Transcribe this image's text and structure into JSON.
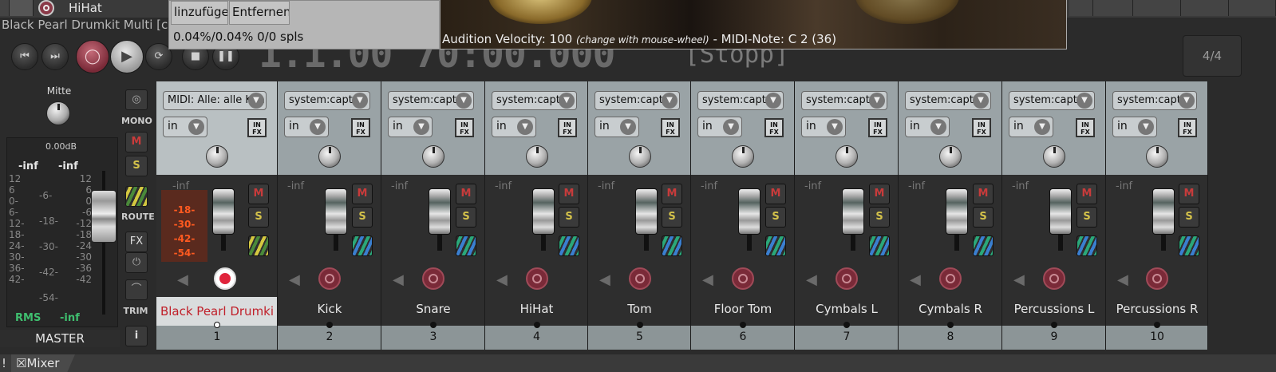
{
  "top": {
    "track_name": "HiHat",
    "session_title": "Black Pearl Drumkit Multi [cl"
  },
  "popup": {
    "btn_add": "linzufüge",
    "btn_remove": "Entfernen",
    "stats": "0.04%/0.04% 0/0 spls",
    "audition_label": "Audition Velocity: 100",
    "audition_hint": "(change with mouse-wheel)",
    "midi_note": "-  MIDI-Note: C 2 (36)"
  },
  "transport": {
    "clock": "1.1.00 70:00.000",
    "status": "[Stopp]",
    "time_sig": "4/4"
  },
  "master": {
    "pan_label": "Mitte",
    "gain": "0.00dB",
    "peak_left": "-inf",
    "peak_right": "-inf",
    "scale_left": [
      "12",
      "6",
      "0-",
      "6-",
      "12-",
      "18-",
      "24-",
      "30-",
      "36-",
      "42-"
    ],
    "scale_mid": [
      "-6-",
      "-18-",
      "-30-",
      "-42-",
      "-54-"
    ],
    "scale_right": [
      "12",
      "6",
      "0",
      "-6",
      "-12",
      "-18",
      "-24",
      "-30",
      "-36",
      "-42"
    ],
    "rms_label": "RMS",
    "rms_value": "-inf",
    "label": "MASTER"
  },
  "side": {
    "mono": "MONO",
    "mute": "M",
    "solo": "S",
    "route": "ROUTE",
    "fx": "FX",
    "trim": "TRIM",
    "info": "i"
  },
  "strips": [
    {
      "input": "MIDI: Alle: alle Kan",
      "in": "in",
      "peak": "-inf",
      "name": "Black Pearl Drumki",
      "num": "1",
      "mute": "M",
      "solo": "S",
      "meter": [
        "-18-",
        "-30-",
        "-42-",
        "-54-"
      ]
    },
    {
      "input": "system:captu",
      "in": "in",
      "peak": "-inf",
      "name": "Kick",
      "num": "2",
      "mute": "M",
      "solo": "S"
    },
    {
      "input": "system:captu",
      "in": "in",
      "peak": "-inf",
      "name": "Snare",
      "num": "3",
      "mute": "M",
      "solo": "S"
    },
    {
      "input": "system:captu",
      "in": "in",
      "peak": "-inf",
      "name": "HiHat",
      "num": "4",
      "mute": "M",
      "solo": "S"
    },
    {
      "input": "system:captu",
      "in": "in",
      "peak": "-inf",
      "name": "Tom",
      "num": "5",
      "mute": "M",
      "solo": "S"
    },
    {
      "input": "system:captu",
      "in": "in",
      "peak": "-inf",
      "name": "Floor Tom",
      "num": "6",
      "mute": "M",
      "solo": "S"
    },
    {
      "input": "system:captu",
      "in": "in",
      "peak": "-inf",
      "name": "Cymbals L",
      "num": "7",
      "mute": "M",
      "solo": "S"
    },
    {
      "input": "system:captu",
      "in": "in",
      "peak": "-inf",
      "name": "Cymbals R",
      "num": "8",
      "mute": "M",
      "solo": "S"
    },
    {
      "input": "system:captu",
      "in": "in",
      "peak": "-inf",
      "name": "Percussions L",
      "num": "9",
      "mute": "M",
      "solo": "S"
    },
    {
      "input": "system:captu",
      "in": "in",
      "peak": "-inf",
      "name": "Percussions R",
      "num": "10",
      "mute": "M",
      "solo": "S"
    }
  ],
  "infx_label": "IN FX",
  "tabbar": {
    "bang": "!",
    "mixer_tab": "☒Mixer"
  }
}
